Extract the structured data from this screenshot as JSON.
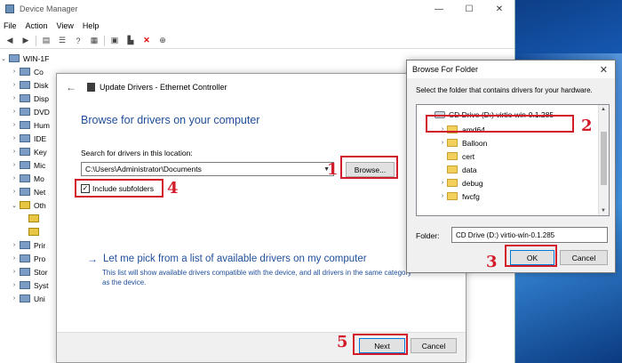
{
  "device_manager": {
    "title": "Device Manager",
    "window_controls": [
      "—",
      "☐",
      "✕"
    ],
    "menu": [
      "File",
      "Action",
      "View",
      "Help"
    ],
    "tree": [
      {
        "label": "WIN-1F",
        "expanded": true
      },
      {
        "label": "Co"
      },
      {
        "label": "Disk"
      },
      {
        "label": "Disp"
      },
      {
        "label": "DVD"
      },
      {
        "label": "Hum"
      },
      {
        "label": "IDE"
      },
      {
        "label": "Key"
      },
      {
        "label": "Mic"
      },
      {
        "label": "Mo"
      },
      {
        "label": "Net"
      },
      {
        "label": "Oth",
        "expanded": true
      },
      {
        "label": ""
      },
      {
        "label": ""
      },
      {
        "label": "Prir"
      },
      {
        "label": "Pro"
      },
      {
        "label": "Stor"
      },
      {
        "label": "Syst"
      },
      {
        "label": "Uni"
      }
    ]
  },
  "update_dialog": {
    "title": "Update Drivers - Ethernet Controller",
    "heading": "Browse for drivers on your computer",
    "search_label": "Search for drivers in this location:",
    "path_value": "C:\\Users\\Administrator\\Documents",
    "browse_label": "Browse...",
    "include_subfolders_label": "Include subfolders",
    "include_subfolders_checked": true,
    "pick_title": "Let me pick from a list of available drivers on my computer",
    "pick_desc": "This list will show available drivers compatible with the device, and all drivers in the same category as the device.",
    "next_label": "Next",
    "cancel_label": "Cancel"
  },
  "browse_folder": {
    "title": "Browse For Folder",
    "prompt": "Select the folder that contains drivers for your hardware.",
    "tree": [
      {
        "label": "CD Drive (D:) virtio-win-0.1.285",
        "type": "drive",
        "expanded": true,
        "selected": true
      },
      {
        "label": "amd64",
        "type": "folder"
      },
      {
        "label": "Balloon",
        "type": "folder"
      },
      {
        "label": "cert",
        "type": "folder"
      },
      {
        "label": "data",
        "type": "folder"
      },
      {
        "label": "debug",
        "type": "folder"
      },
      {
        "label": "fwcfg",
        "type": "folder"
      }
    ],
    "folder_label": "Folder:",
    "folder_value": "CD Drive (D:) virtio-win-0.1.285",
    "ok_label": "OK",
    "cancel_label": "Cancel",
    "close_glyph": "✕"
  },
  "annotations": [
    "1",
    "2",
    "3",
    "4",
    "5"
  ],
  "colors": {
    "highlight": "#d21c2a",
    "link_blue": "#1f4e9a",
    "default_button_border": "#0078d7"
  }
}
